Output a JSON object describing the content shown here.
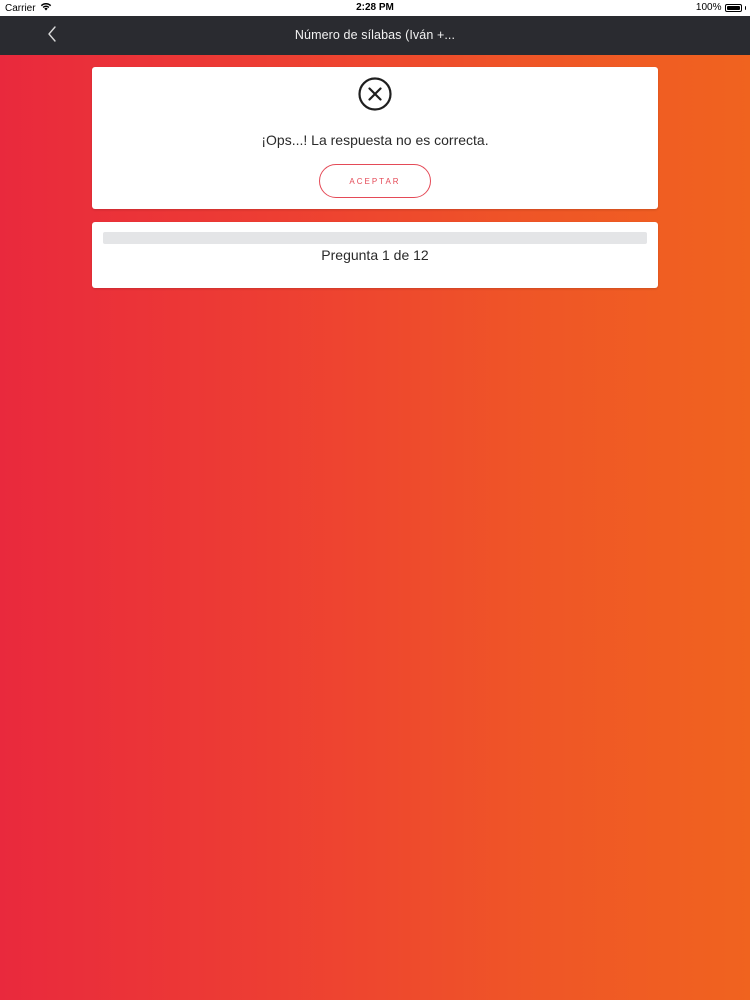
{
  "status_bar": {
    "carrier": "Carrier",
    "time": "2:28 PM",
    "battery_percent": "100%"
  },
  "nav": {
    "title": "Número de sílabas (Iván +...",
    "back_icon": "chevron-left-icon"
  },
  "feedback": {
    "icon": "close-circle-icon",
    "message": "¡Ops...! La respuesta no es correcta.",
    "accept_label": "ACEPTAR",
    "accent_color": "#e44a57"
  },
  "progress": {
    "label": "Pregunta 1 de 12",
    "current": 1,
    "total": 12,
    "fill_fraction": 0
  },
  "colors": {
    "background_start": "#e9293d",
    "background_end": "#f0631f",
    "nav_bar": "#2a2b30"
  }
}
